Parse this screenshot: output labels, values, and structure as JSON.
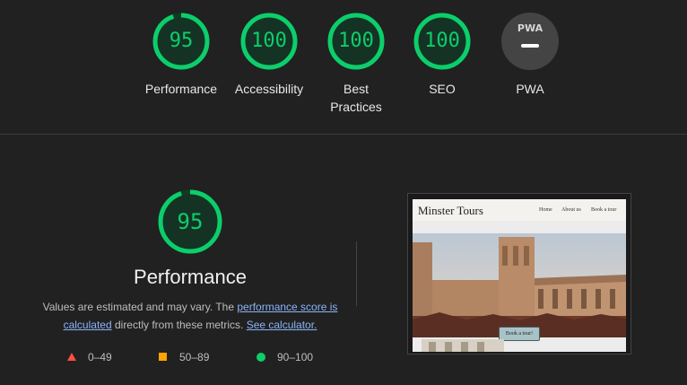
{
  "categories": [
    {
      "score": "95",
      "label": "Performance",
      "fraction": 0.95
    },
    {
      "score": "100",
      "label": "Accessibility",
      "fraction": 1.0
    },
    {
      "score": "100",
      "label": "Best Practices",
      "fraction": 1.0
    },
    {
      "score": "100",
      "label": "SEO",
      "fraction": 1.0
    },
    {
      "badge": "PWA",
      "label": "PWA"
    }
  ],
  "colors": {
    "pass": "#0cce6b",
    "average": "#ffa400",
    "fail": "#ff4e42",
    "ring_track": "#0a3d22"
  },
  "performance": {
    "score": "95",
    "fraction": 0.95,
    "title": "Performance",
    "desc_prefix": "Values are estimated and may vary. The ",
    "link_score": "performance score is calculated",
    "desc_middle": " directly from these metrics. ",
    "link_calc": "See calculator."
  },
  "legend": [
    {
      "icon": "triangle-icon",
      "range": "0–49"
    },
    {
      "icon": "square-icon",
      "range": "50–89"
    },
    {
      "icon": "circle-icon",
      "range": "90–100"
    }
  ],
  "screenshot": {
    "brand": "Minster Tours",
    "nav": [
      "Home",
      "About us",
      "Book a tour"
    ],
    "button": "Book a tour!"
  }
}
